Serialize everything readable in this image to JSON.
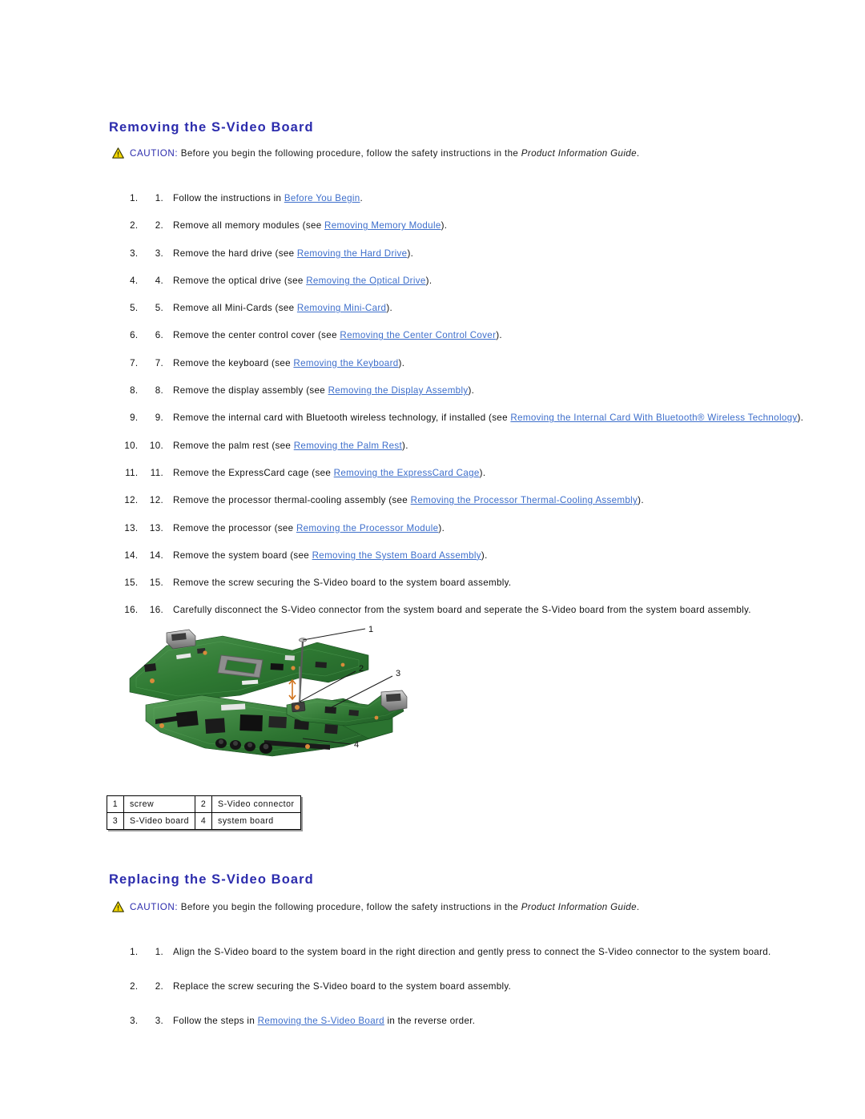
{
  "document": {
    "sections": [
      {
        "id": "removing",
        "heading": "Removing the S-Video Board",
        "caution": {
          "icon": "warning-triangle-icon",
          "label": "CAUTION:",
          "text_before": " Before you begin the following procedure, follow the safety instructions in the ",
          "italic_text": "Product Information Guide",
          "text_after": "."
        },
        "steps": [
          {
            "num": "1.",
            "before": "Follow the instructions in ",
            "link": "Before You Begin",
            "after": "."
          },
          {
            "num": "2.",
            "before": "Remove all memory modules (see ",
            "link": "Removing Memory Module",
            "after": ")."
          },
          {
            "num": "3.",
            "before": "Remove the hard drive (see ",
            "link": "Removing the Hard Drive",
            "after": ")."
          },
          {
            "num": "4.",
            "before": "Remove the optical drive (see ",
            "link": "Removing the Optical Drive",
            "after": ")."
          },
          {
            "num": "5.",
            "before": "Remove all Mini-Cards (see ",
            "link": "Removing Mini-Card",
            "after": ")."
          },
          {
            "num": "6.",
            "before": "Remove the center control cover (see ",
            "link": "Removing the Center Control Cover",
            "after": ")."
          },
          {
            "num": "7.",
            "before": "Remove the keyboard (see ",
            "link": "Removing the Keyboard",
            "after": ")."
          },
          {
            "num": "8.",
            "before": "Remove the display assembly (see ",
            "link": "Removing the Display Assembly",
            "after": ")."
          },
          {
            "num": "9.",
            "before": "Remove the internal card with Bluetooth wireless technology, if installed (see ",
            "link": "Removing the Internal Card With Bluetooth® Wireless Technology",
            "after": ")."
          },
          {
            "num": "10.",
            "before": "Remove the palm rest (see ",
            "link": "Removing the Palm Rest",
            "after": ")."
          },
          {
            "num": "11.",
            "before": "Remove the ExpressCard cage (see ",
            "link": "Removing the ExpressCard Cage",
            "after": ")."
          },
          {
            "num": "12.",
            "before": "Remove the processor thermal-cooling assembly (see ",
            "link": "Removing the Processor Thermal-Cooling Assembly",
            "after": ")."
          },
          {
            "num": "13.",
            "before": "Remove the processor (see ",
            "link": "Removing the Processor Module",
            "after": ")."
          },
          {
            "num": "14.",
            "before": "Remove the system board (see ",
            "link": "Removing the System Board Assembly",
            "after": ")."
          },
          {
            "num": "15.",
            "before": "Remove the screw securing the S-Video board to the system board assembly.",
            "link": "",
            "after": ""
          },
          {
            "num": "16.",
            "before": "Carefully disconnect the S-Video connector from the system board and seperate the S-Video board from the system board assembly.",
            "link": "",
            "after": ""
          }
        ]
      },
      {
        "id": "replacing",
        "heading": "Replacing the S-Video Board",
        "caution": {
          "icon": "warning-triangle-icon",
          "label": "CAUTION:",
          "text_before": " Before you begin the following procedure, follow the safety instructions in the ",
          "italic_text": "Product Information Guide",
          "text_after": "."
        },
        "steps": [
          {
            "num": "1.",
            "before": "Align the S-Video board to the system board in the right direction and gently press to connect the S-Video connector to the system board.",
            "link": "",
            "after": ""
          },
          {
            "num": "2.",
            "before": "Replace the screw securing the S-Video board to the system board assembly.",
            "link": "",
            "after": ""
          },
          {
            "num": "3.",
            "before": "Follow the steps in ",
            "link": "Removing the S-Video Board",
            "after": " in the reverse order."
          }
        ]
      }
    ]
  },
  "illustration": {
    "alt": "system board assembly with S-Video board exploded view",
    "callouts": [
      {
        "id": "1",
        "label": "1"
      },
      {
        "id": "2",
        "label": "2"
      },
      {
        "id": "3",
        "label": "3"
      },
      {
        "id": "4",
        "label": "4"
      }
    ]
  },
  "legend": {
    "rows": [
      [
        {
          "key": "1",
          "value": "screw"
        },
        {
          "key": "2",
          "value": "S-Video connector"
        }
      ],
      [
        {
          "key": "3",
          "value": "S-Video board"
        },
        {
          "key": "4",
          "value": "system board"
        }
      ]
    ]
  },
  "colors": {
    "heading": "#2c2cad",
    "link": "#3d6ecb",
    "caution_label": "#2c2cad",
    "body_text": "#111111",
    "pcb_green": "#2f7a33",
    "page_background": "#ffffff"
  }
}
